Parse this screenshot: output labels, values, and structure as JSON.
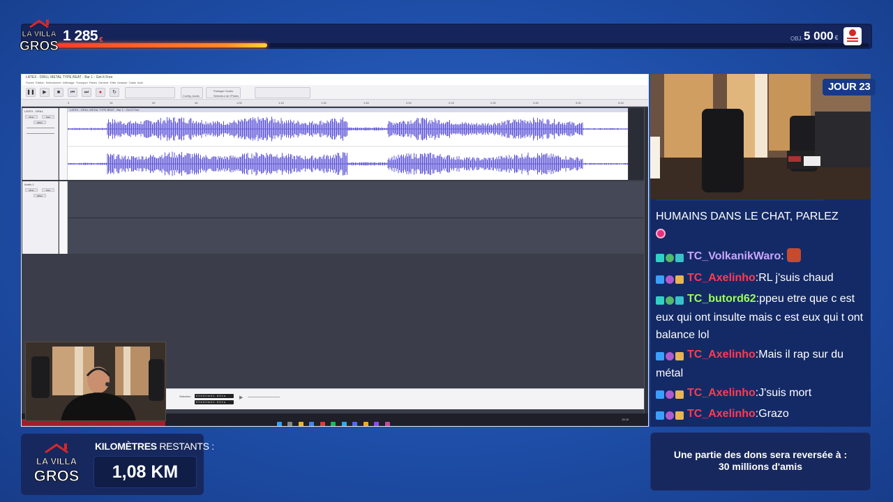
{
  "overlay": {
    "logo_text": "LA VILLA DES GROS",
    "donation_total": "1 285",
    "donation_currency": "€",
    "donation_progress_pct": 26,
    "objective_label": "OBJ.",
    "objective_amount": "5 000",
    "objective_currency": "€",
    "day_badge": "JOUR 23",
    "km_label_bold": "KILOMÈTRES",
    "km_label_rest": " RESTANTS :",
    "km_value": "1,08 KM",
    "donation_note_line1": "Une partie des dons sera reversée à :",
    "donation_note_line2": "30 millions d'amis",
    "accent_color": "#ff4b3a",
    "brand_color": "#1e4ea8"
  },
  "audacity": {
    "title": "LATEX - DRILL METAL TYPE BEAT - Bar 1 - Get It Free",
    "menu": [
      "Fichier",
      "Édition",
      "Sélectionner",
      "Affichage",
      "Transport",
      "Pistes",
      "Générer",
      "Effet",
      "Analyse",
      "Outils",
      "Aide"
    ],
    "toolbar": {
      "pause": "❚❚",
      "play": "▶",
      "stop": "■",
      "skip_start": "⏮",
      "skip_end": "⏭",
      "record": "●",
      "loop": "↻",
      "audio_setup": "Config. Audio",
      "share_audio": "Partager l'Audio",
      "sync_lock": "Sélecteur de l'Pistes"
    },
    "ruler_ticks": [
      "0",
      "15",
      "30",
      "45",
      "1:00",
      "1:15",
      "1:30",
      "1:45",
      "2:00",
      "2:15",
      "2:30",
      "2:45",
      "3:00",
      "3:15"
    ],
    "track1": {
      "name": "LATEX - DRILL",
      "mute": "Mute",
      "solo": "Solo",
      "effects": "Effets",
      "clip_title": "LATEX - DRILL METAL TYPE BEAT - Bar 1 - Get It Free"
    },
    "track2": {
      "name": "Audio 1",
      "mute": "Mute",
      "solo": "Solo",
      "effects": "Effets"
    },
    "selection_label": "Sélection",
    "selection_start": "0 0 h 0 0 m 0 1 . 5 5 1 s",
    "selection_end": "0 0 h 0 0 m 0 1 . 5 5 1 s",
    "tray_time": "15:18"
  },
  "chat": {
    "messages": [
      {
        "user": "",
        "text": "HUMAINS DANS LE CHAT, PARLEZ",
        "color": "#ffffff"
      },
      {
        "user": "TC_VolkanikWaro",
        "text": "",
        "color": "#c9a6ff",
        "emote": true
      },
      {
        "user": "TC_Axelinho",
        "text": "RL j'suis chaud",
        "color": "#ff3b4e"
      },
      {
        "user": "TC_butord62",
        "text": "ppeu etre que c est eux qui ont insulte mais c est eux qui t ont balance lol",
        "color": "#9cff5a"
      },
      {
        "user": "TC_Axelinho",
        "text": "Mais il rap sur du métal",
        "color": "#ff3b4e"
      },
      {
        "user": "TC_Axelinho",
        "text": "J'suis mort",
        "color": "#ff3b4e"
      },
      {
        "user": "TC_Axelinho",
        "text": "Grazo",
        "color": "#ff3b4e"
      }
    ],
    "separator": ":"
  }
}
